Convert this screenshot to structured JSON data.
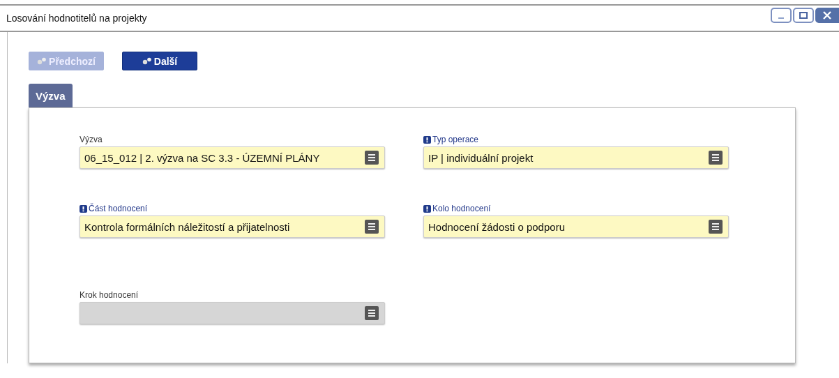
{
  "window": {
    "title": "Losování hodnotitelů na projekty"
  },
  "buttons": [
    {
      "label": "Předchozí",
      "disabled": true
    },
    {
      "label": "Další",
      "disabled": false
    }
  ],
  "tabs": [
    {
      "label": "Výzva",
      "selected": true
    }
  ],
  "fields": [
    {
      "label": "Výzva",
      "required": false,
      "value": "06_15_012 | 2. výzva na SC 3.3 - ÚZEMNÍ PLÁNY",
      "disabled": false
    },
    {
      "label": "Typ operace",
      "required": true,
      "value": "IP | individuální projekt",
      "disabled": false
    },
    {
      "label": "Část hodnocení",
      "required": true,
      "value": "Kontrola formálních náležitostí a přijatelnosti",
      "disabled": false
    },
    {
      "label": "Kolo hodnocení",
      "required": true,
      "value": "Hodnocení žádosti o podporu",
      "disabled": false
    },
    {
      "label": "Krok hodnocení",
      "required": false,
      "disabled": true
    }
  ]
}
